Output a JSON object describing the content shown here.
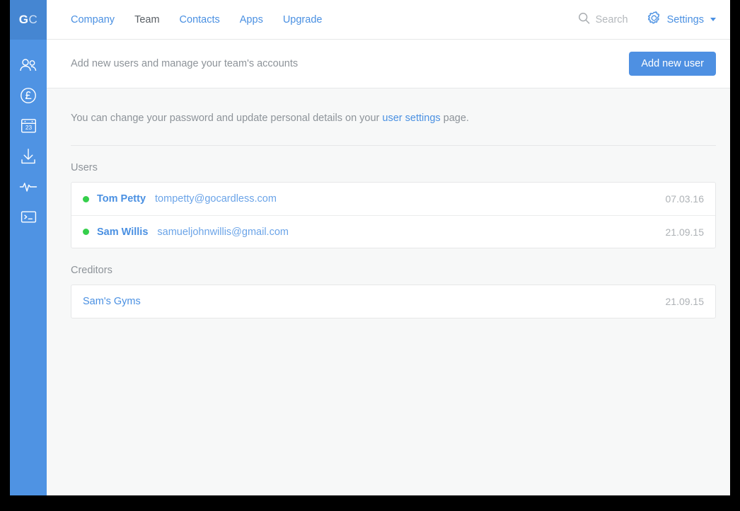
{
  "brand": {
    "logo_primary": "G",
    "logo_secondary": "C",
    "accent_blue": "#4a90e2",
    "rail_blue": "#4f93e3",
    "status_green": "#35cf4b"
  },
  "rail": {
    "icons": [
      {
        "name": "users-icon",
        "label": "Users"
      },
      {
        "name": "pound-circle-icon",
        "label": "Payments"
      },
      {
        "name": "calendar-23-icon",
        "label": "Schedule"
      },
      {
        "name": "download-icon",
        "label": "Exports"
      },
      {
        "name": "activity-pulse-icon",
        "label": "Activity"
      },
      {
        "name": "terminal-icon",
        "label": "Developer"
      }
    ]
  },
  "topnav": {
    "links": [
      {
        "label": "Company",
        "active": false
      },
      {
        "label": "Team",
        "active": true
      },
      {
        "label": "Contacts",
        "active": false
      },
      {
        "label": "Apps",
        "active": false
      },
      {
        "label": "Upgrade",
        "active": false
      }
    ],
    "search_placeholder": "Search",
    "settings_label": "Settings"
  },
  "subheader": {
    "description": "Add new users and manage your team's accounts",
    "add_user_label": "Add new user"
  },
  "helper": {
    "before_link": "You can change your password and update personal details on your ",
    "link_label": "user settings",
    "after_link": " page."
  },
  "users_section": {
    "title": "Users",
    "rows": [
      {
        "name": "Tom Petty",
        "email": "tompetty@gocardless.com",
        "date": "07.03.16",
        "status": "active"
      },
      {
        "name": "Sam Willis",
        "email": "samueljohnwillis@gmail.com",
        "date": "21.09.15",
        "status": "active"
      }
    ]
  },
  "creditors_section": {
    "title": "Creditors",
    "rows": [
      {
        "name": "Sam's Gyms",
        "date": "21.09.15"
      }
    ]
  }
}
